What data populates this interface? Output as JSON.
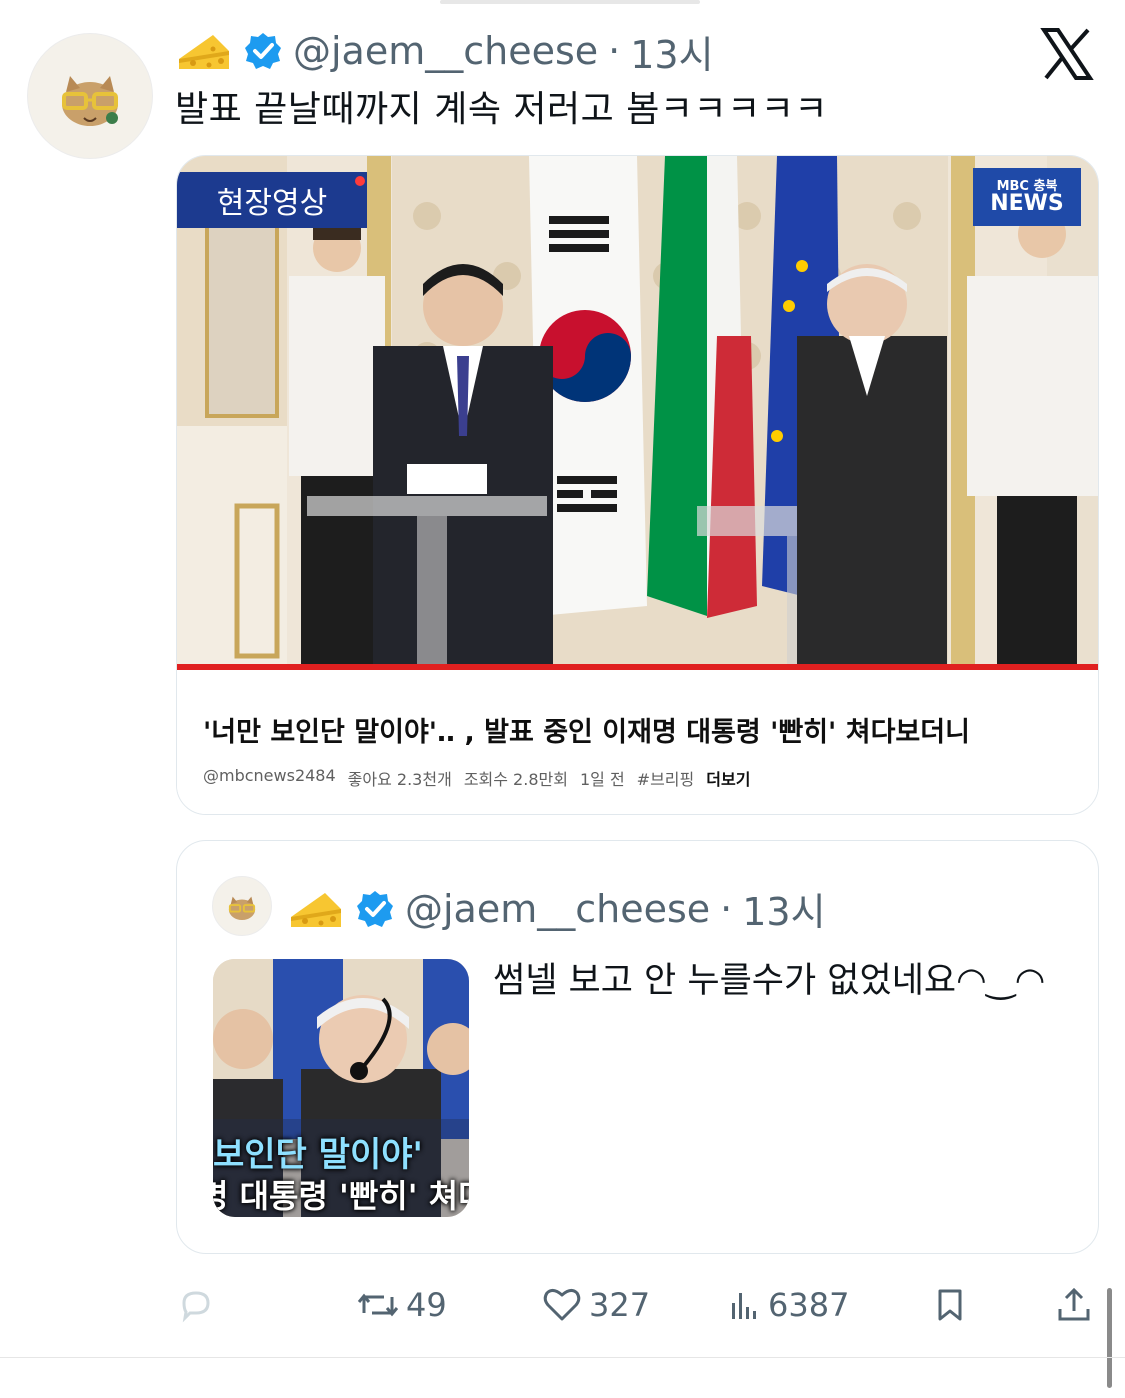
{
  "post": {
    "handle": "@jaem__cheese",
    "separator": "·",
    "time": "13시",
    "text": "발표 끝날때까지 계속 저러고 봄ㅋㅋㅋㅋㅋ",
    "emoji_icon": "cheese-emoji",
    "verified_color": "#1d9bf0"
  },
  "video": {
    "live_badge": "현장영상",
    "news_badge_small": "MBC 충북",
    "news_badge_big": "NEWS",
    "title": "'너만 보인단 말이야'‥ , 발표 중인 이재명 대통령 '빤히' 쳐다보더니",
    "channel": "@mbcnews2484",
    "likes": "좋아요 2.3천개",
    "views": "조회수 2.8만회",
    "age": "1일 전",
    "hashtag": "#브리핑",
    "more": "더보기",
    "progress_fraction": 1.0
  },
  "quote": {
    "handle": "@jaem__cheese",
    "separator": "·",
    "time": "13시",
    "text": "썸넬 보고 안 누를수가 없었네요◠‿◠",
    "thumb_line1": "보인단 말이야'",
    "thumb_line2": "명 대통령 '빤히' 쳐다"
  },
  "actions": {
    "reply_count": "",
    "repost_count": "49",
    "like_count": "327",
    "views_count": "6387"
  },
  "colors": {
    "muted": "#536471",
    "accent_red": "#e02020",
    "badge_blue": "#1c3a8f"
  }
}
